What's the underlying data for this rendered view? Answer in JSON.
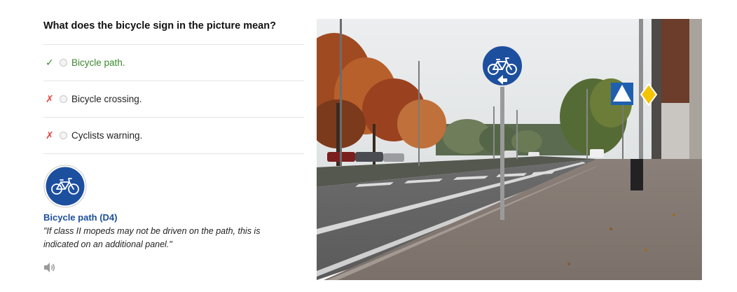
{
  "question": {
    "text": "What does the bicycle sign in the picture mean?"
  },
  "options": [
    {
      "label": "Bicycle path.",
      "status": "correct",
      "mark": "✓"
    },
    {
      "label": "Bicycle crossing.",
      "status": "wrong",
      "mark": "✗"
    },
    {
      "label": "Cyclists warning.",
      "status": "wrong",
      "mark": "✗"
    }
  ],
  "sign_info": {
    "title": "Bicycle path (D4)",
    "description": "\"If class II mopeds may not be driven on the path, this is indicated on an additional panel.\""
  },
  "icons": {
    "correct_mark": "check-icon",
    "wrong_mark": "cross-icon",
    "sign": "bicycle-path-sign-icon",
    "audio": "speaker-icon"
  },
  "colors": {
    "correct": "#3a8a2c",
    "wrong": "#e04444",
    "sign_blue": "#1d4f9f",
    "title_blue": "#1a4f9c"
  }
}
